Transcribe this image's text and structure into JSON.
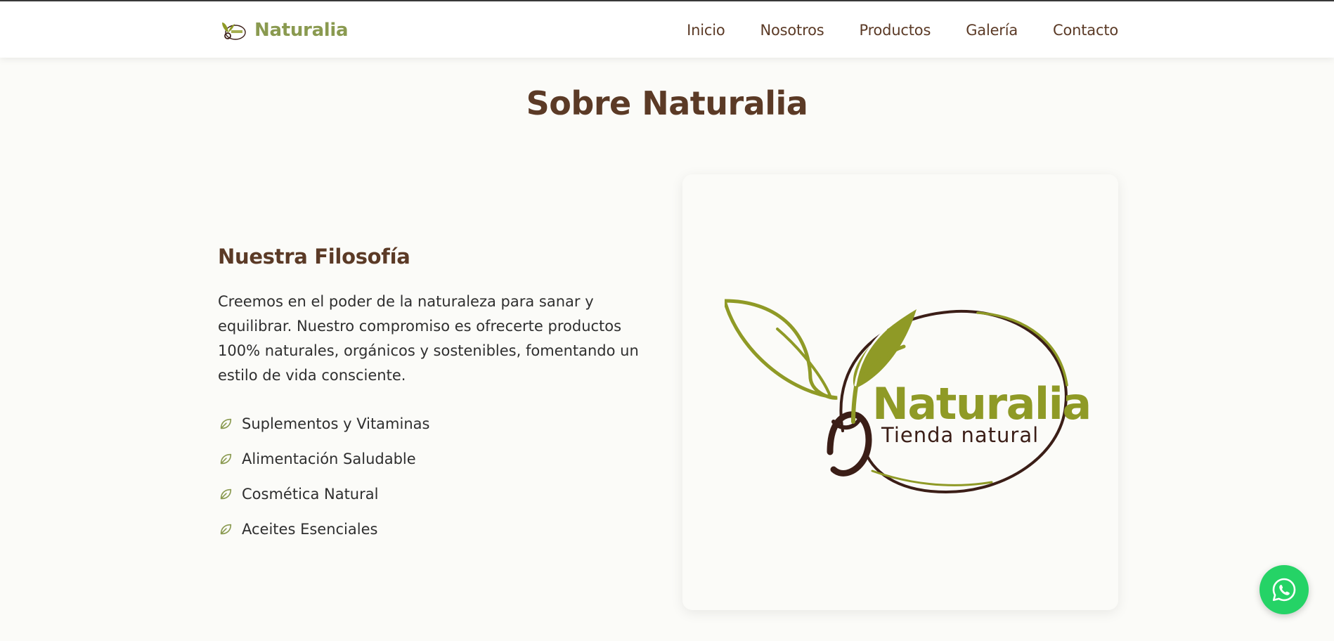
{
  "colors": {
    "brand_green": "#8a9a50",
    "brown": "#5b3a26",
    "logo_olive": "#8f9a26",
    "logo_dark_brown": "#3b1e17",
    "whatsapp_green": "#25d366",
    "background": "#fbfbf8"
  },
  "navbar": {
    "brand_name": "Naturalia",
    "brand_icon": "naturalia-logo-icon",
    "links": [
      "Inicio",
      "Nosotros",
      "Productos",
      "Galería",
      "Contacto"
    ]
  },
  "about": {
    "section_title": "Sobre Naturalia",
    "philosophy_title": "Nuestra Filosofía",
    "philosophy_text": "Creemos en el poder de la naturaleza para sanar y equilibrar. Nuestro compromiso es ofrecerte productos 100% naturales, orgánicos y sostenibles, fomentando un estilo de vida consciente.",
    "feature_icon": "leaf-icon",
    "features": [
      "Suplementos y Vitaminas",
      "Alimentación Saludable",
      "Cosmética Natural",
      "Aceites Esenciales"
    ],
    "logo": {
      "name": "Naturalia",
      "tagline": "Tienda natural"
    }
  },
  "floating": {
    "whatsapp_icon": "whatsapp-icon"
  }
}
